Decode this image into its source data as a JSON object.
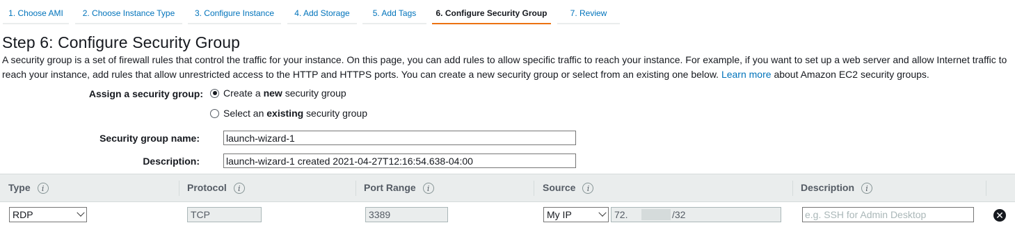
{
  "wizard": {
    "steps": [
      {
        "label": "1. Choose AMI"
      },
      {
        "label": "2. Choose Instance Type"
      },
      {
        "label": "3. Configure Instance"
      },
      {
        "label": "4. Add Storage"
      },
      {
        "label": "5. Add Tags"
      },
      {
        "label": "6. Configure Security Group"
      },
      {
        "label": "7. Review"
      }
    ],
    "active_step": 6
  },
  "page": {
    "title": "Step 6: Configure Security Group",
    "intro_text": "A security group is a set of firewall rules that control the traffic for your instance. On this page, you can add rules to allow specific traffic to reach your instance. For example, if you want to set up a web server and allow Internet traffic to reach your instance, add rules that allow unrestricted access to the HTTP and HTTPS ports. You can create a new security group or select from an existing one below.",
    "learn_more_link": "Learn more",
    "intro_suffix": "about Amazon EC2 security groups."
  },
  "form": {
    "assign_label": "Assign a security group:",
    "option_new_prefix": "Create a ",
    "option_new_bold": "new",
    "option_new_suffix": " security group",
    "option_existing_prefix": "Select an ",
    "option_existing_bold": "existing",
    "option_existing_suffix": " security group",
    "selected_option": "new",
    "name_label": "Security group name:",
    "name_value": "launch-wizard-1",
    "description_label": "Description:",
    "description_value": "launch-wizard-1 created 2021-04-27T12:16:54.638-04:00"
  },
  "rules_table": {
    "columns": [
      {
        "label": "Type"
      },
      {
        "label": "Protocol"
      },
      {
        "label": "Port Range"
      },
      {
        "label": "Source"
      },
      {
        "label": "Description"
      }
    ],
    "info_icon_glyph": "i",
    "rows": [
      {
        "type": "RDP",
        "protocol": "TCP",
        "port_range": "3389",
        "source_type": "My IP",
        "source_ip_prefix": "72.",
        "source_ip_suffix": "/32",
        "description_placeholder": "e.g. SSH for Admin Desktop",
        "remove_glyph": "✕"
      }
    ]
  },
  "colors": {
    "link": "#0073bb",
    "active_tab_underline": "#ec7211",
    "table_header_bg": "#eaeded"
  }
}
